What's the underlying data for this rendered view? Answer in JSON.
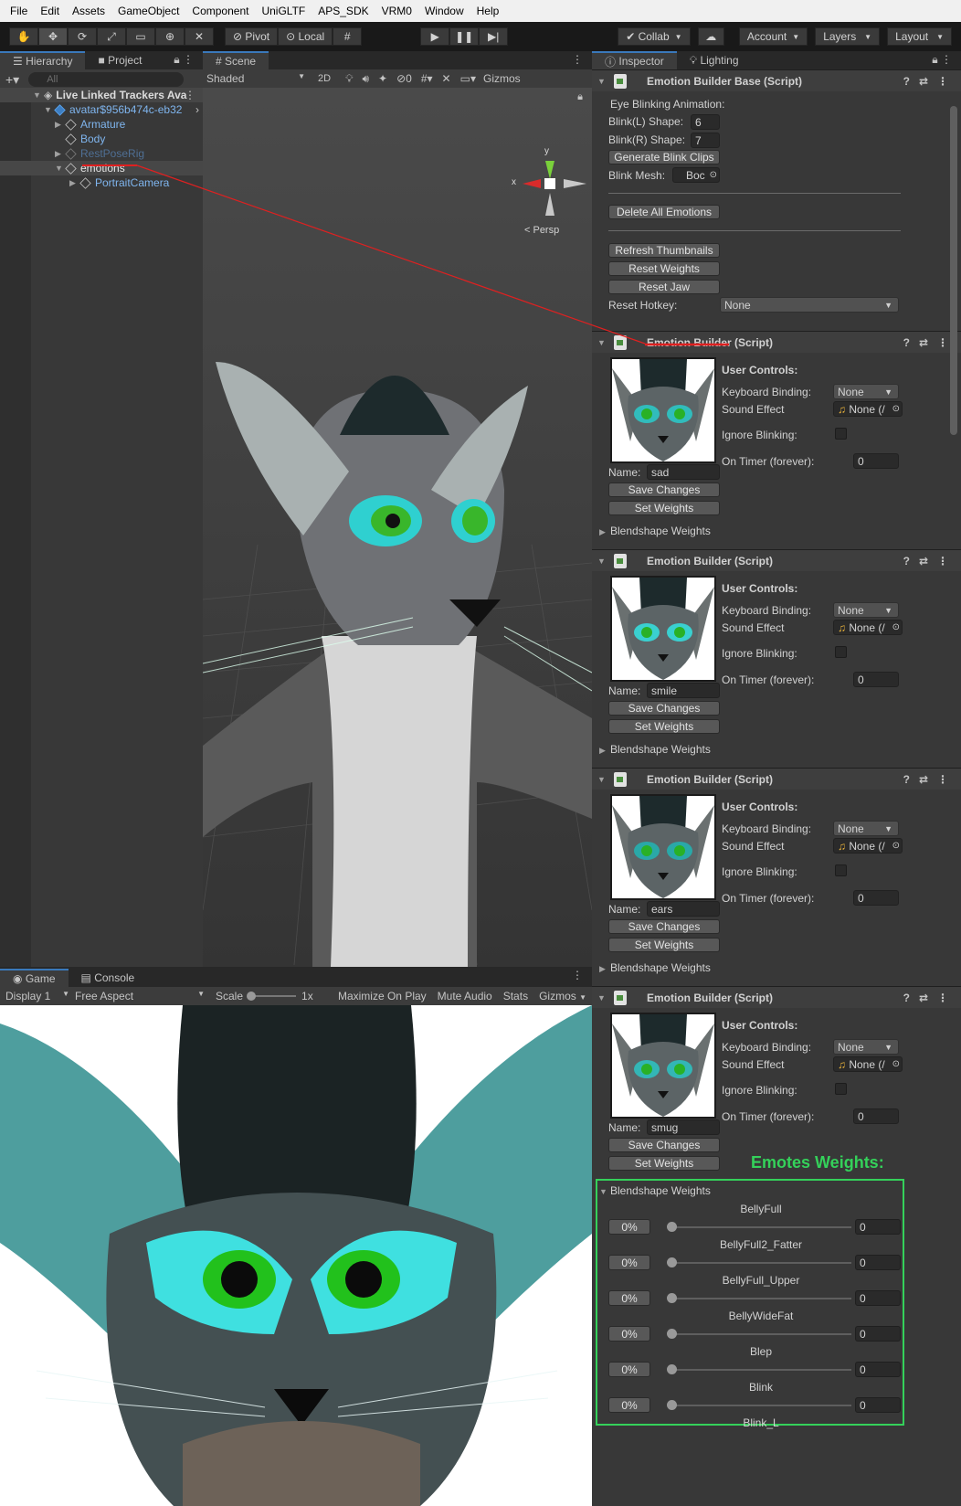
{
  "menu": [
    "File",
    "Edit",
    "Assets",
    "GameObject",
    "Component",
    "UniGLTF",
    "APS_SDK",
    "VRM0",
    "Window",
    "Help"
  ],
  "toolbar": {
    "pivot": "Pivot",
    "local": "Local",
    "collab": "Collab",
    "account": "Account",
    "layers": "Layers",
    "layout": "Layout"
  },
  "hierarchy": {
    "tab": "Hierarchy",
    "project_tab": "Project",
    "search_placeholder": "All",
    "items": [
      {
        "label": "Live Linked Trackers Ava",
        "indent": 0
      },
      {
        "label": "avatar$956b474c-eb32",
        "indent": 1
      },
      {
        "label": "Armature",
        "indent": 2
      },
      {
        "label": "Body",
        "indent": 2
      },
      {
        "label": "RestPoseRig",
        "indent": 2
      },
      {
        "label": "emotions",
        "indent": 2
      },
      {
        "label": "PortraitCamera",
        "indent": 3
      }
    ]
  },
  "scene": {
    "tab": "Scene",
    "shading": "Shaded",
    "mode_2d": "2D",
    "hidden_count": "0",
    "gizmos": "Gizmos",
    "persp": "< Persp",
    "axis_x": "x",
    "axis_y": "y"
  },
  "game": {
    "tab": "Game",
    "console_tab": "Console",
    "display": "Display 1",
    "aspect": "Free Aspect",
    "scale_label": "Scale",
    "scale_value": "1x",
    "maximize": "Maximize On Play",
    "mute": "Mute Audio",
    "stats": "Stats",
    "gizmos": "Gizmos"
  },
  "inspector": {
    "tab": "Inspector",
    "lighting_tab": "Lighting",
    "base": {
      "title": "Emotion Builder Base (Script)",
      "eye_blinking": "Eye Blinking Animation:",
      "blink_l_label": "Blink(L) Shape:",
      "blink_l_value": "6",
      "blink_r_label": "Blink(R) Shape:",
      "blink_r_value": "7",
      "generate": "Generate Blink Clips",
      "blink_mesh_label": "Blink Mesh:",
      "blink_mesh_value": "Boc",
      "delete_all": "Delete All Emotions",
      "refresh": "Refresh Thumbnails",
      "reset_weights": "Reset Weights",
      "reset_jaw": "Reset Jaw",
      "reset_hotkey_label": "Reset Hotkey:",
      "reset_hotkey_value": "None"
    },
    "builder_labels": {
      "title": "Emotion Builder (Script)",
      "user_controls": "User Controls:",
      "keyboard": "Keyboard Binding:",
      "keyboard_value": "None",
      "sound": "Sound Effect",
      "sound_value": "None (/",
      "ignore": "Ignore Blinking:",
      "timer": "On Timer (forever):",
      "timer_value": "0",
      "name": "Name:",
      "save": "Save Changes",
      "set": "Set Weights",
      "blendshape": "Blendshape Weights"
    },
    "emotions": [
      {
        "name": "sad"
      },
      {
        "name": "smile"
      },
      {
        "name": "ears"
      },
      {
        "name": "smug"
      }
    ],
    "annotation": "Emotes Weights:",
    "blendshapes": [
      {
        "name": "BellyFull",
        "pct": "0%",
        "value": "0",
        "level": 0
      },
      {
        "name": "BellyFull2_Fatter",
        "pct": "0%",
        "value": "0",
        "level": 0
      },
      {
        "name": "BellyFull_Upper",
        "pct": "0%",
        "value": "0",
        "level": 0
      },
      {
        "name": "BellyWideFat",
        "pct": "0%",
        "value": "0",
        "level": 0
      },
      {
        "name": "Blep",
        "pct": "0%",
        "value": "0",
        "level": 0
      },
      {
        "name": "Blink",
        "pct": "0%",
        "value": "0",
        "level": 0
      },
      {
        "name": "Blink_L",
        "pct": "",
        "value": "",
        "level": 0
      }
    ]
  },
  "colors": {
    "annotation_green": "#34d15a",
    "annotation_red": "#e02020",
    "selection": "#2c5d87"
  }
}
